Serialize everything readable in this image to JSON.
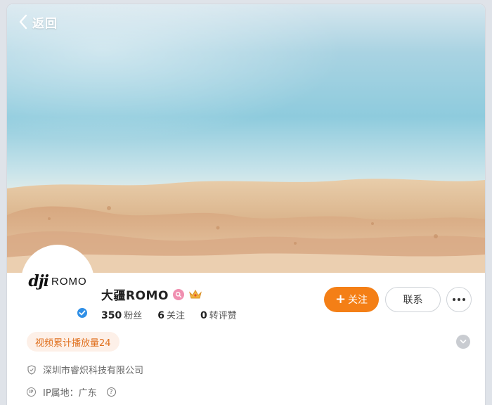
{
  "nav": {
    "back_label": "返回"
  },
  "profile": {
    "avatar_brand": "dji",
    "avatar_product": "ROMO",
    "name": "大疆ROMO",
    "stats": [
      {
        "value": "350",
        "label": "粉丝"
      },
      {
        "value": "6",
        "label": "关注"
      },
      {
        "value": "0",
        "label": "转评赞"
      }
    ]
  },
  "actions": {
    "follow_label": "关注",
    "contact_label": "联系"
  },
  "play_badge": "视频累计播放量24",
  "info": {
    "company": "深圳市睿炽科技有限公司",
    "ip_location": "IP属地：广东"
  },
  "colors": {
    "accent": "#f47f16",
    "verified": "#2f8fe6",
    "badge_bg": "#fdf0e8",
    "badge_text": "#e0701e"
  },
  "icons": {
    "back": "chevron-left-icon",
    "verified": "verified-icon",
    "pink_badge": "search-badge-icon",
    "crown": "crown-icon",
    "more": "more-dots-icon",
    "expand": "chevron-down-icon",
    "company": "shield-icon",
    "ip": "ip-icon",
    "help": "question-icon"
  }
}
